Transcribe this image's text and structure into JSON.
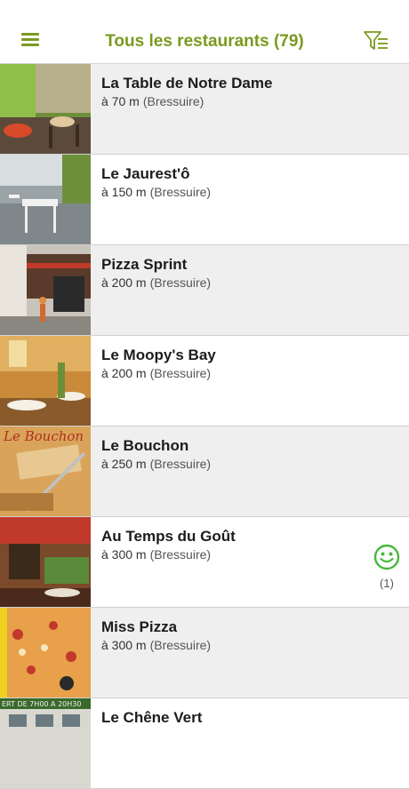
{
  "header": {
    "title": "Tous les restaurants (79)"
  },
  "colors": {
    "accent": "#7a9a1e",
    "rating": "#47b83a"
  },
  "restaurants": [
    {
      "name": "La Table de Notre Dame",
      "distance": "à 70 m",
      "city": "(Bressuire)"
    },
    {
      "name": "Le Jaurest'ô",
      "distance": "à 150 m",
      "city": "(Bressuire)"
    },
    {
      "name": "Pizza Sprint",
      "distance": "à 200 m",
      "city": "(Bressuire)"
    },
    {
      "name": "Le Moopy's Bay",
      "distance": "à 200 m",
      "city": "(Bressuire)"
    },
    {
      "name": "Le Bouchon",
      "distance": "à 250 m",
      "city": "(Bressuire)",
      "thumb_text": "Le Bouchon"
    },
    {
      "name": "Au Temps du Goût",
      "distance": "à 300 m",
      "city": "(Bressuire)",
      "rating_count": "(1)"
    },
    {
      "name": "Miss Pizza",
      "distance": "à 300 m",
      "city": "(Bressuire)"
    },
    {
      "name": "Le Chêne Vert",
      "distance": "",
      "city": "",
      "thumb_text": "ERT DE 7H00 A 20H30"
    }
  ]
}
